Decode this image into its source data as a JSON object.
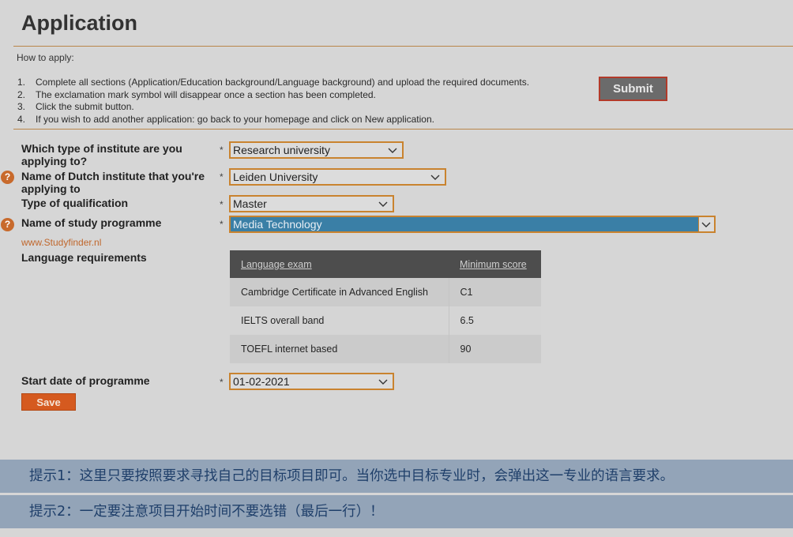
{
  "header": {
    "title": "Application"
  },
  "instructions": {
    "title": "How to apply:",
    "steps": [
      {
        "num": "1.",
        "text": "Complete all sections (Application/Education background/Language background) and upload the required documents."
      },
      {
        "num": "2.",
        "text": "The exclamation mark symbol will disappear once a section has been completed."
      },
      {
        "num": "3.",
        "text": "Click the submit button."
      },
      {
        "num": "4.",
        "text": "If you wish to add another application: go back to your homepage and click on New application."
      }
    ],
    "submit_label": "Submit"
  },
  "form": {
    "required_mark": "*",
    "help_icon_glyph": "?",
    "institute_type": {
      "label_line1": "Which type of institute are you",
      "label_line2": "applying to?",
      "value": "Research university"
    },
    "dutch_institute": {
      "label_line1": "Name of Dutch institute that you're",
      "label_line2": "applying to",
      "value": "Leiden University"
    },
    "qualification": {
      "label": "Type of qualification",
      "value": "Master"
    },
    "study_programme": {
      "label": "Name of study programme",
      "value": "Media Technology"
    },
    "studyfinder_link": "www.Studyfinder.nl",
    "language_requirements": {
      "label": "Language requirements",
      "columns": [
        "Language exam",
        "Minimum score"
      ],
      "rows": [
        [
          "Cambridge Certificate in Advanced English",
          "C1"
        ],
        [
          "IELTS overall band",
          "6.5"
        ],
        [
          "TOEFL internet based",
          "90"
        ]
      ]
    },
    "start_date": {
      "label": "Start date of programme",
      "value": "01-02-2021"
    },
    "save_label": "Save"
  },
  "hints": [
    "提示1：这里只要按照要求寻找自己的目标项目即可。当你选中目标专业时，会弹出这一专业的语言要求。",
    "提示2：一定要注意项目开始时间不要选错（最后一行）！"
  ],
  "colors": {
    "accent": "#c9832f",
    "save": "#d55a1f",
    "highlight": "#3a7fa6",
    "hint_bg": "#93a4b8",
    "hint_text": "#1f3f6a"
  }
}
